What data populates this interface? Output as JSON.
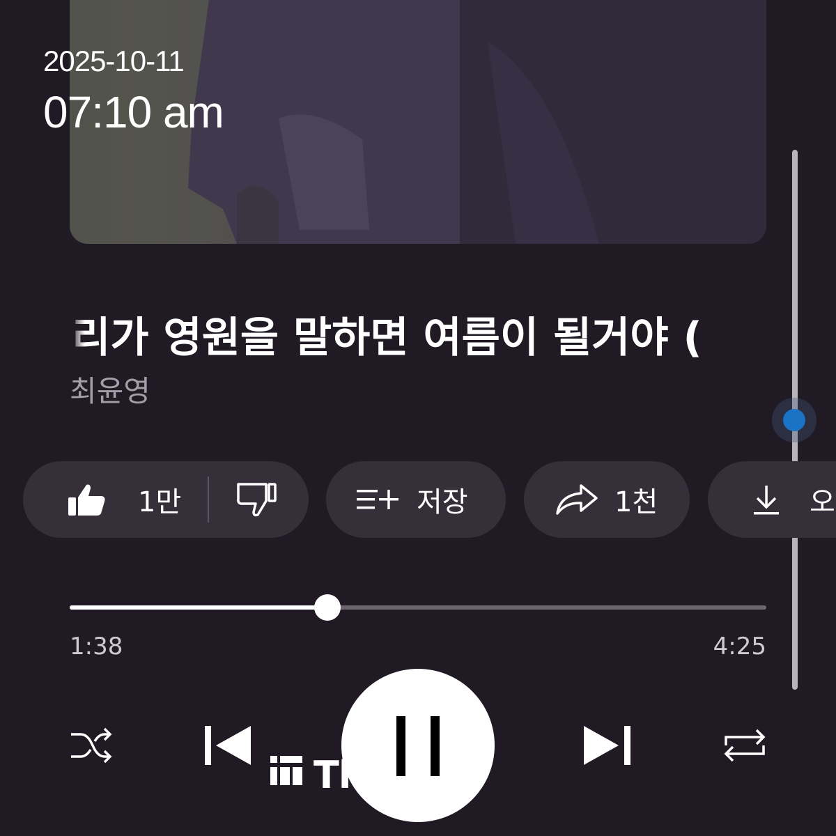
{
  "status_overlay": {
    "date": "2025-10-11",
    "time": "07:10 am"
  },
  "track": {
    "title": "우리가 영원을 말하면 여름이 될거야 (",
    "artist": "최윤영"
  },
  "actions": {
    "like_count": "1만",
    "save_label": "저장",
    "share_count": "1천",
    "download_label": "오"
  },
  "playback": {
    "current_time": "1:38",
    "total_time": "4:25",
    "progress_fraction": 0.37,
    "state": "playing"
  },
  "scroll": {
    "position_fraction": 0.5
  },
  "colors": {
    "background": "#201a25",
    "chip": "#352f3a",
    "accent_blue": "#1a73c4",
    "secondary_text": "#a39ea8"
  },
  "icons": {
    "like": "thumbs-up-icon",
    "dislike": "thumbs-down-icon",
    "save": "playlist-add-icon",
    "share": "share-arrow-icon",
    "download": "download-icon",
    "shuffle": "shuffle-icon",
    "previous": "skip-previous-icon",
    "pause": "pause-icon",
    "next": "skip-next-icon",
    "repeat": "repeat-icon"
  },
  "watermark": {
    "text": "Threads"
  }
}
